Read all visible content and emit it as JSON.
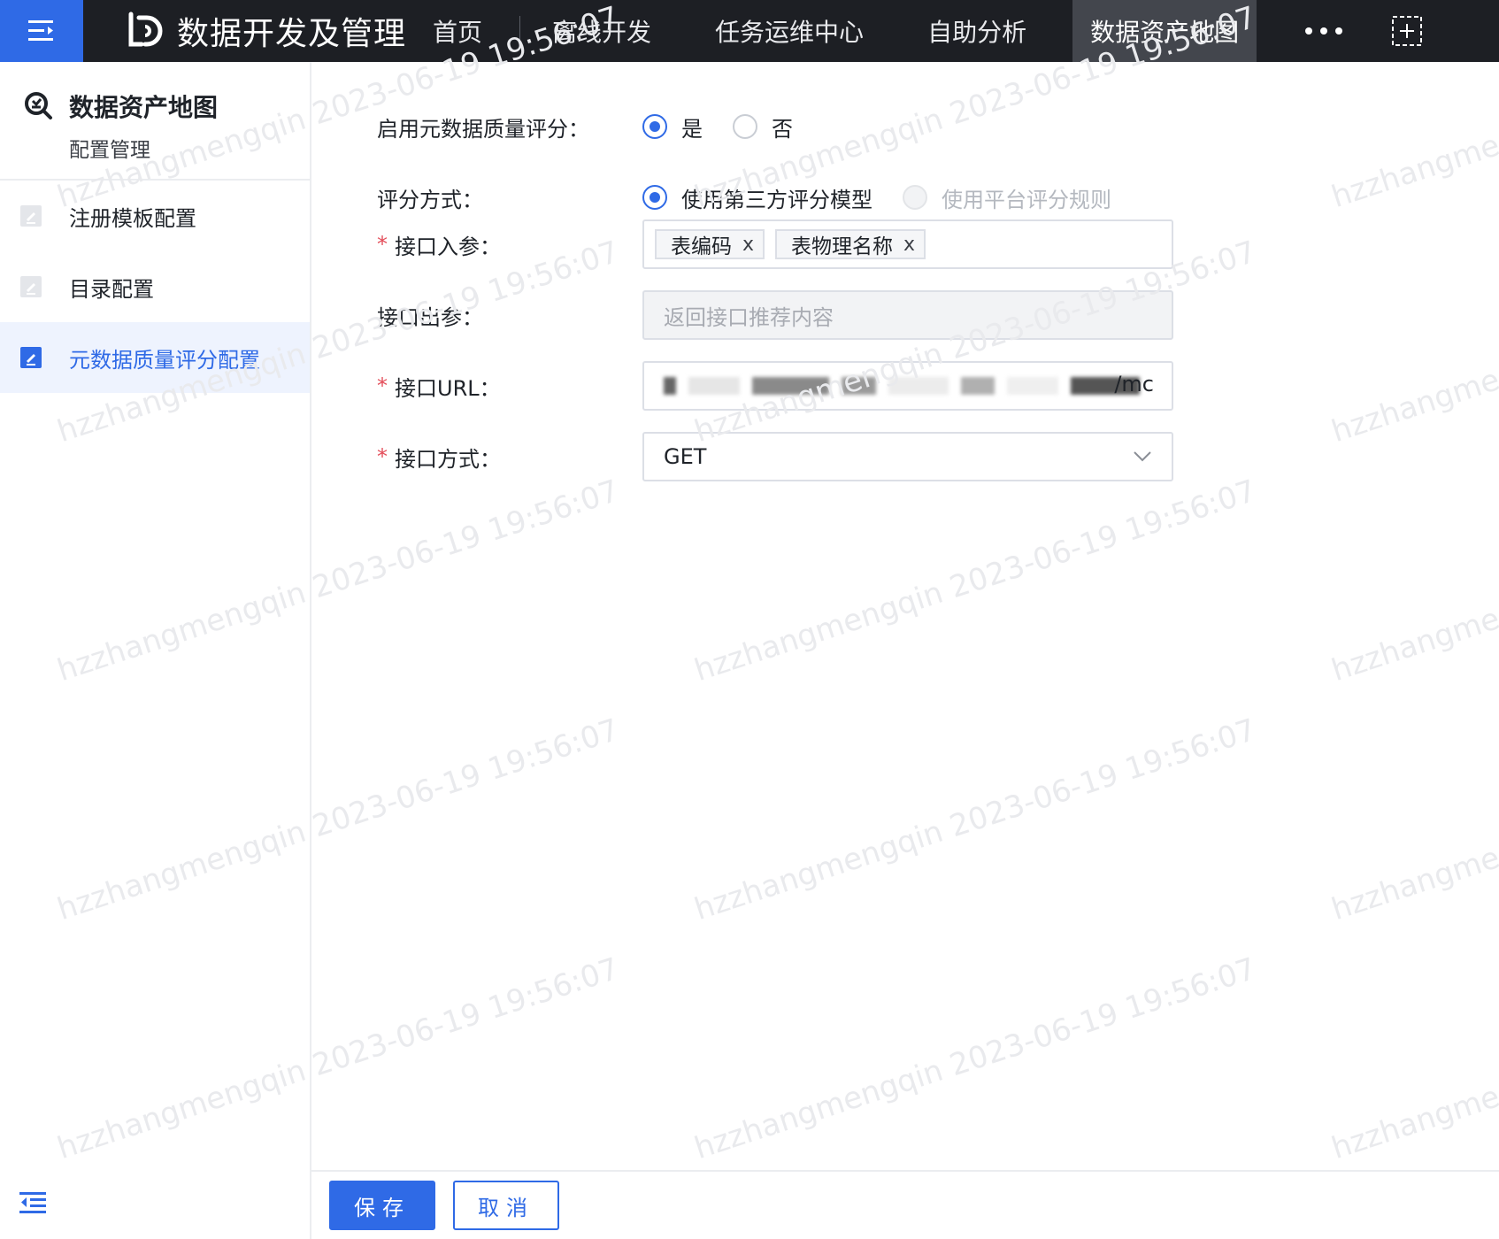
{
  "topbar": {
    "brand_title": "数据开发及管理",
    "nav": [
      {
        "label": "首页"
      },
      {
        "label": "离线开发"
      },
      {
        "label": "任务运维中心"
      },
      {
        "label": "自助分析"
      },
      {
        "label": "数据资产地图"
      }
    ],
    "active_nav": "数据资产地图"
  },
  "sidebar": {
    "title": "数据资产地图",
    "subtitle": "配置管理",
    "items": [
      {
        "label": "注册模板配置"
      },
      {
        "label": "目录配置"
      },
      {
        "label": "元数据质量评分配置"
      }
    ],
    "active_item": "元数据质量评分配置"
  },
  "form": {
    "enable": {
      "label": "启用元数据质量评分：",
      "options": [
        "是",
        "否"
      ],
      "selected": "是"
    },
    "method": {
      "label": "评分方式：",
      "options": [
        "使用第三方评分模型",
        "使用平台评分规则"
      ],
      "selected": "使用第三方评分模型",
      "disabled": "使用平台评分规则"
    },
    "input_params": {
      "required": "*",
      "label": "接口入参：",
      "tags": [
        "表编码",
        "表物理名称"
      ],
      "tag_close": "x"
    },
    "output_params": {
      "label": "接口出参：",
      "placeholder": "返回接口推荐内容"
    },
    "url": {
      "required": "*",
      "label": "接口URL：",
      "visible_tail": "/mc"
    },
    "http_method": {
      "required": "*",
      "label": "接口方式：",
      "value": "GET"
    }
  },
  "footer": {
    "save": "保存",
    "cancel": "取消"
  },
  "watermark": "hzzhangmengqin 2023-06-19 19:56:07",
  "colors": {
    "accent": "#2f6ae6",
    "topbar": "#1d1f24",
    "required": "#e34d59"
  }
}
